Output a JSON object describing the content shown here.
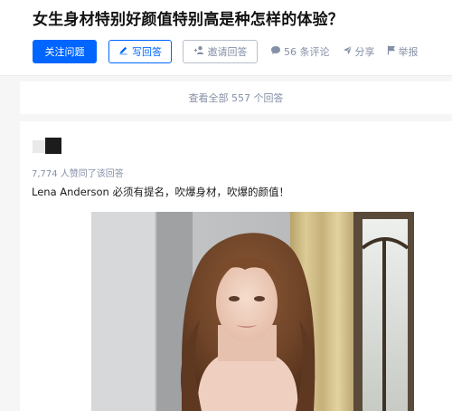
{
  "question": {
    "title": "女生身材特别好颜值特别高是种怎样的体验？"
  },
  "actions": {
    "follow_label": "关注问题",
    "write_label": "写回答",
    "invite_label": "邀请回答",
    "comments_label": "56 条评论",
    "share_label": "分享",
    "report_label": "举报"
  },
  "view_all": {
    "label": "查看全部 557 个回答"
  },
  "answer": {
    "votes_text": "7,774 人赞同了该回答",
    "text": "Lena Anderson 必须有提名，吹爆身材，吹爆的颜值！"
  },
  "colors": {
    "brand_blue": "#0066ff",
    "muted_gray": "#8590a6",
    "page_bg": "#f6f6f6"
  },
  "icons": {
    "write": "pencil-icon",
    "invite": "add-user-icon",
    "comments": "comment-bubble-icon",
    "share": "paper-plane-icon",
    "report": "flag-icon"
  }
}
